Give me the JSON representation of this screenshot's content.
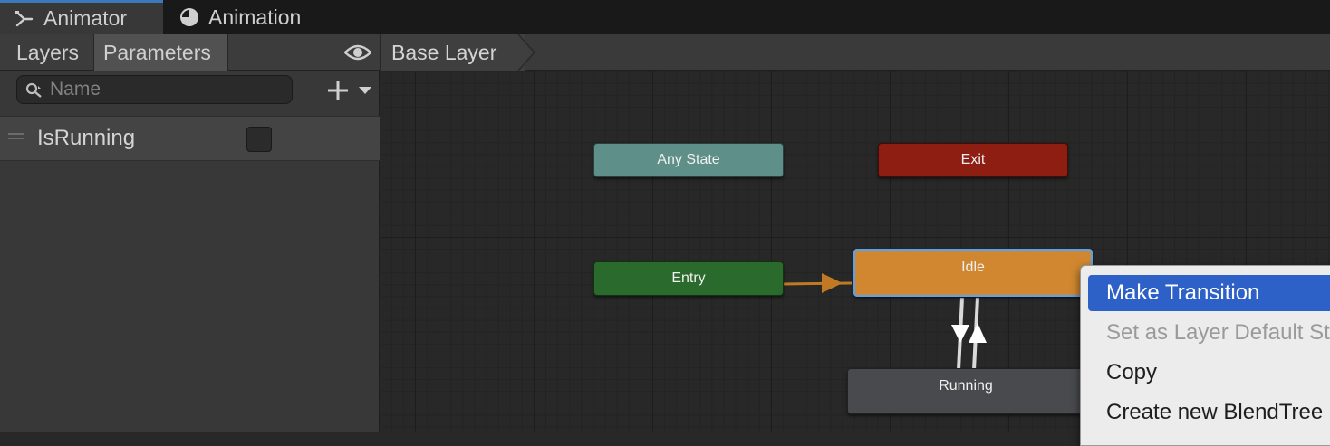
{
  "window_tabs": [
    {
      "label": "Animator",
      "icon": "animator-icon",
      "active": true
    },
    {
      "label": "Animation",
      "icon": "animation-clock-icon",
      "active": false
    }
  ],
  "left_panel": {
    "tabs": [
      {
        "label": "Layers",
        "active": false
      },
      {
        "label": "Parameters",
        "active": true
      }
    ],
    "search": {
      "placeholder": "Name",
      "value": ""
    },
    "parameters": [
      {
        "name": "IsRunning",
        "type": "bool",
        "checked": false
      }
    ]
  },
  "breadcrumb": {
    "layer": "Base Layer"
  },
  "graph": {
    "states": {
      "any_state": {
        "label": "Any State",
        "color": "#5f8f89"
      },
      "exit": {
        "label": "Exit",
        "color": "#8e1d12"
      },
      "entry": {
        "label": "Entry",
        "color": "#2a6a2c"
      },
      "idle": {
        "label": "Idle",
        "color": "#d08730",
        "selected": true
      },
      "running": {
        "label": "Running",
        "color": "#494a4d"
      }
    }
  },
  "context_menu": {
    "items": [
      {
        "label": "Make Transition",
        "highlighted": true,
        "enabled": true
      },
      {
        "label": "Set as Layer Default State",
        "enabled": false
      },
      {
        "label": "Copy",
        "enabled": true
      },
      {
        "label": "Create new BlendTree in State",
        "enabled": true
      }
    ]
  },
  "colors": {
    "accent": "#3a79bb",
    "menu_highlight": "#2e61c8",
    "selection_outline": "#5aa1f0"
  }
}
